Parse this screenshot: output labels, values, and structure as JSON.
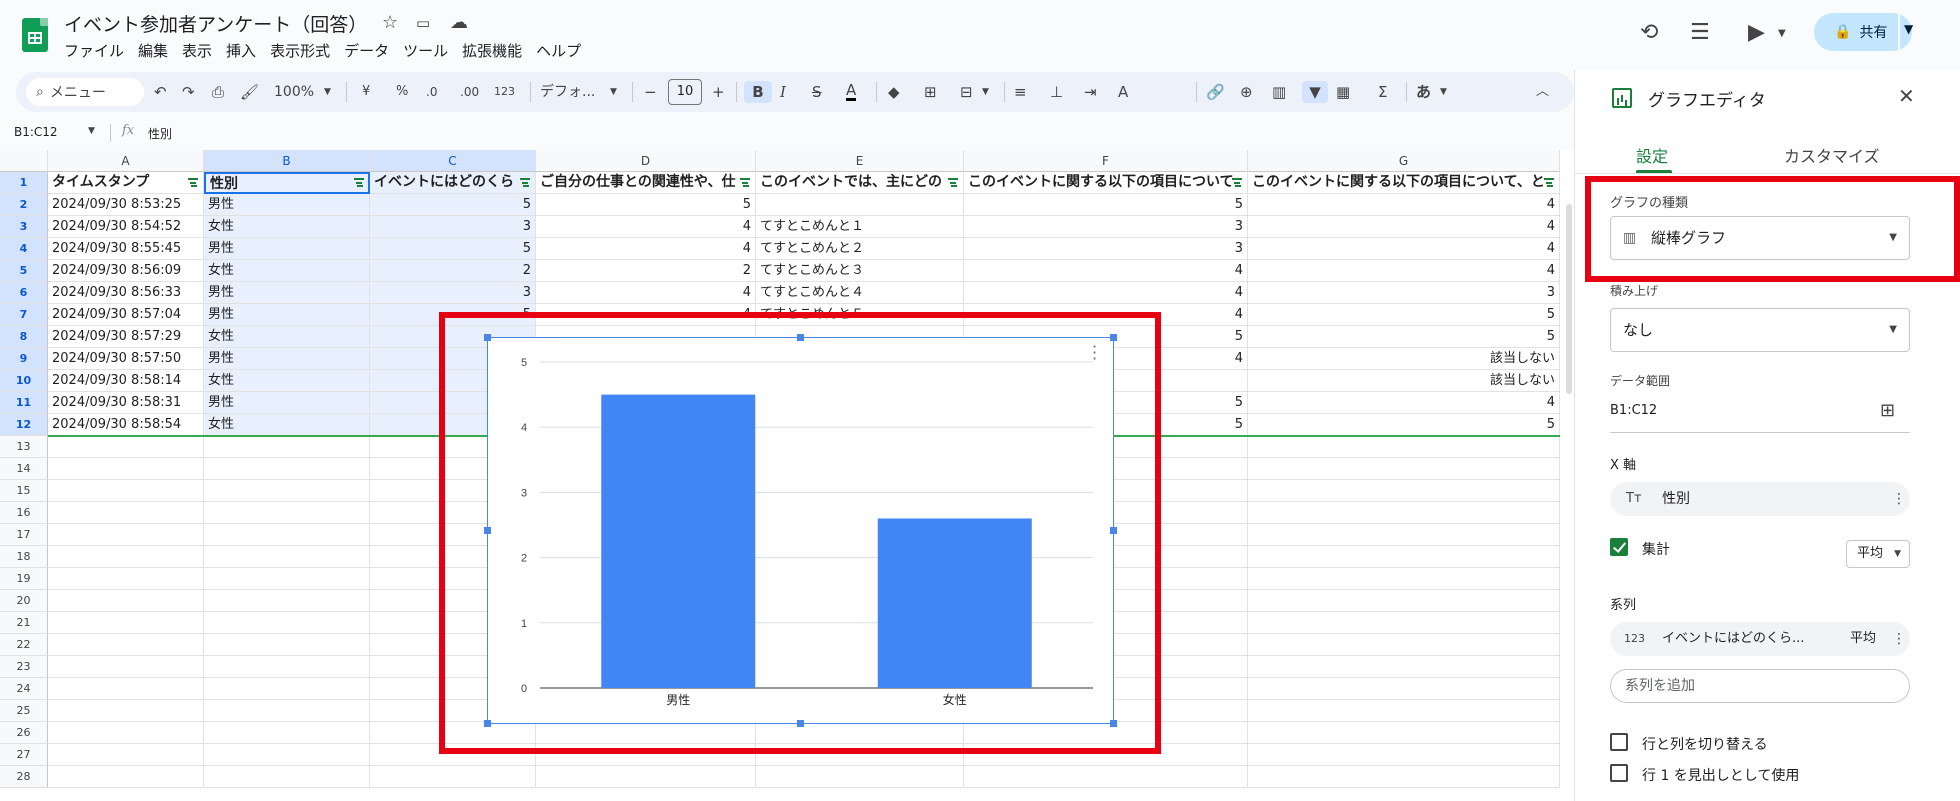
{
  "header": {
    "title": "イベント参加者アンケート（回答）",
    "menus": [
      "ファイル",
      "編集",
      "表示",
      "挿入",
      "表示形式",
      "データ",
      "ツール",
      "拡張機能",
      "ヘルプ"
    ],
    "share_label": "共有"
  },
  "toolbar": {
    "search_label": "メニュー",
    "zoom": "100%",
    "currency": "¥",
    "percent": "%",
    "decrease_decimal": ".0",
    "increase_decimal": ".00",
    "number_format": "123",
    "font": "デフォ...",
    "font_size": "10",
    "input_mode": "あ"
  },
  "formula_bar": {
    "name_box": "B1:C12",
    "value": "性別"
  },
  "sheet": {
    "columns": [
      "A",
      "B",
      "C",
      "D",
      "E",
      "F",
      "G"
    ],
    "headers": [
      "タイムスタンプ",
      "性別",
      "イベントにはどのくら",
      "ご自分の仕事との関連性や、仕",
      "このイベントでは、主にどの",
      "このイベントに関する以下の項目について",
      "このイベントに関する以下の項目について、と"
    ],
    "rows": [
      [
        "2024/09/30 8:53:25",
        "男性",
        "5",
        "5",
        "",
        "5",
        "4"
      ],
      [
        "2024/09/30 8:54:52",
        "女性",
        "3",
        "4",
        "てすとこめんと１",
        "3",
        "4"
      ],
      [
        "2024/09/30 8:55:45",
        "男性",
        "5",
        "4",
        "てすとこめんと２",
        "3",
        "4"
      ],
      [
        "2024/09/30 8:56:09",
        "女性",
        "2",
        "2",
        "てすとこめんと３",
        "4",
        "4"
      ],
      [
        "2024/09/30 8:56:33",
        "男性",
        "3",
        "4",
        "てすとこめんと４",
        "4",
        "3"
      ],
      [
        "2024/09/30 8:57:04",
        "男性",
        "5",
        "4",
        "てすとこめんと５",
        "4",
        "5"
      ],
      [
        "2024/09/30 8:57:29",
        "女性",
        "",
        "",
        "",
        "5",
        "5"
      ],
      [
        "2024/09/30 8:57:50",
        "男性",
        "",
        "",
        "",
        "4",
        "該当しない"
      ],
      [
        "2024/09/30 8:58:14",
        "女性",
        "",
        "",
        "",
        "",
        "該当しない"
      ],
      [
        "2024/09/30 8:58:31",
        "男性",
        "",
        "",
        "",
        "5",
        "4"
      ],
      [
        "2024/09/30 8:58:54",
        "女性",
        "",
        "",
        "",
        "5",
        "5"
      ]
    ],
    "row_numbers": [
      "1",
      "2",
      "3",
      "4",
      "5",
      "6",
      "7",
      "8",
      "9",
      "10",
      "11",
      "12",
      "13",
      "14",
      "15",
      "16",
      "17",
      "18",
      "19",
      "20",
      "21",
      "22",
      "23",
      "24",
      "25",
      "26",
      "27",
      "28"
    ]
  },
  "chart_data": {
    "type": "bar",
    "categories": [
      "男性",
      "女性"
    ],
    "values": [
      4.5,
      2.6
    ],
    "ylim": [
      0,
      5
    ],
    "yticks": [
      "0",
      "1",
      "2",
      "3",
      "4",
      "5"
    ],
    "title": "",
    "xlabel": "",
    "ylabel": "",
    "bar_color": "#4285f4"
  },
  "panel": {
    "title": "グラフエディタ",
    "tabs": [
      "設定",
      "カスタマイズ"
    ],
    "chart_type_label": "グラフの種類",
    "chart_type_value": "縦棒グラフ",
    "stacking_label": "積み上げ",
    "stacking_value": "なし",
    "data_range_label": "データ範囲",
    "data_range_value": "B1:C12",
    "x_axis_label": "X 軸",
    "x_axis_value": "性別",
    "aggregate_label": "集計",
    "series_label": "系列",
    "series_agg": "平均",
    "series_item": "イベントにはどのくら...",
    "series_item_agg": "平均",
    "add_series": "系列を追加",
    "switch_rows_cols": "行と列を切り替える",
    "use_row1_header": "行 1 を見出しとして使用"
  }
}
